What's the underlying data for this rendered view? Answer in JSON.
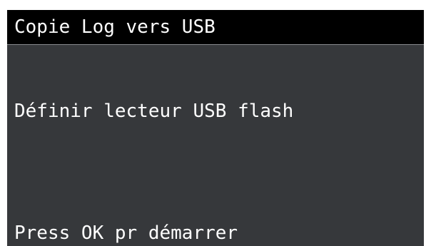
{
  "screen": {
    "title": "Copie Log vers USB",
    "instruction": "Définir lecteur USB flash",
    "action_hint": "Press OK pr démarrer"
  },
  "colors": {
    "title_bar_bg": "#000000",
    "screen_bg": "#36383b",
    "text": "#ffffff",
    "frame": "#ffffff"
  }
}
